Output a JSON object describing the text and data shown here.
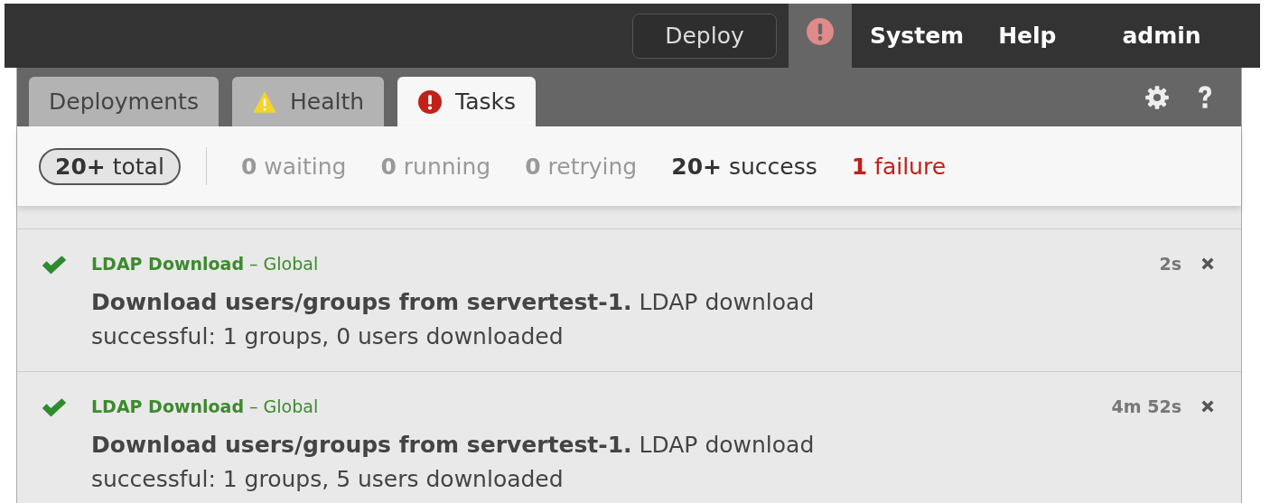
{
  "top_nav": {
    "deploy_button": "Deploy",
    "alerts": {
      "selected": true
    },
    "items": [
      {
        "label": "System",
        "kind": "menu"
      },
      {
        "label": "Help",
        "kind": "menu"
      },
      {
        "label": "admin",
        "kind": "user"
      }
    ]
  },
  "tabs": [
    {
      "label": "Deployments",
      "selected": false,
      "kind": "plain"
    },
    {
      "label": "Health",
      "selected": false,
      "kind": "warning"
    },
    {
      "label": "Tasks",
      "selected": true,
      "kind": "error"
    }
  ],
  "stats": [
    {
      "count": "20+",
      "label": "total",
      "kind": "total"
    },
    {
      "count": "0",
      "label": "waiting",
      "kind": "muted"
    },
    {
      "count": "0",
      "label": "running",
      "kind": "muted"
    },
    {
      "count": "0",
      "label": "retrying",
      "kind": "muted"
    },
    {
      "count": "20+",
      "label": "success",
      "kind": "strong"
    },
    {
      "count": "1",
      "label": "failure",
      "kind": "failure"
    }
  ],
  "tasks": [
    {
      "kind": "success",
      "title": "LDAP Download",
      "scope": "– Global",
      "message": "**Download users/groups from servertest-1.** LDAP download successful: 1 groups, 0 users downloaded",
      "time": "2s"
    },
    {
      "kind": "success",
      "title": "LDAP Download",
      "scope": "– Global",
      "message": "**Download users/groups from servertest-1.** LDAP download successful: 1 groups, 5 users downloaded",
      "time": "4m 52s"
    }
  ]
}
